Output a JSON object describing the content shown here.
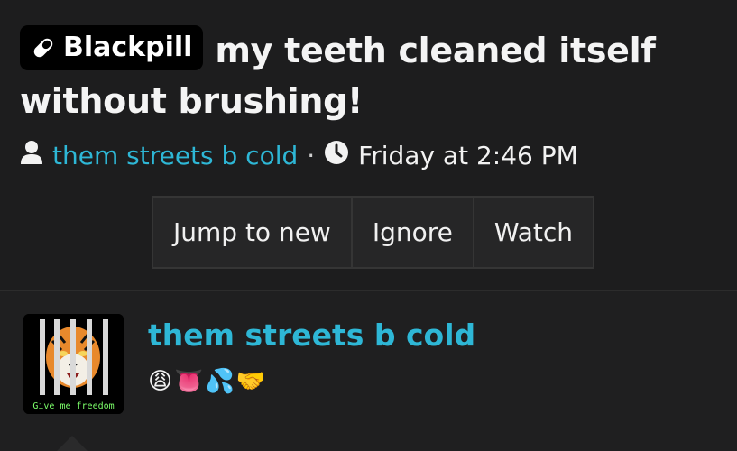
{
  "thread": {
    "prefix_label": "Blackpill",
    "title": "my teeth cleaned itself without brushing!",
    "author": "them streets b cold",
    "separator": "·",
    "date": "Friday at 2:46 PM"
  },
  "actions": {
    "jump_label": "Jump to new",
    "ignore_label": "Ignore",
    "watch_label": "Watch"
  },
  "post": {
    "username": "them streets b cold",
    "signature_emojis": "😩👅💦🤝",
    "avatar_caption": "Give me freedom"
  },
  "icons": {
    "prefix": "pill-icon",
    "author": "user-icon",
    "date": "clock-icon"
  },
  "colors": {
    "accent": "#2eb7d6",
    "background": "#1d1d1e",
    "prefix_bg": "#000000"
  }
}
